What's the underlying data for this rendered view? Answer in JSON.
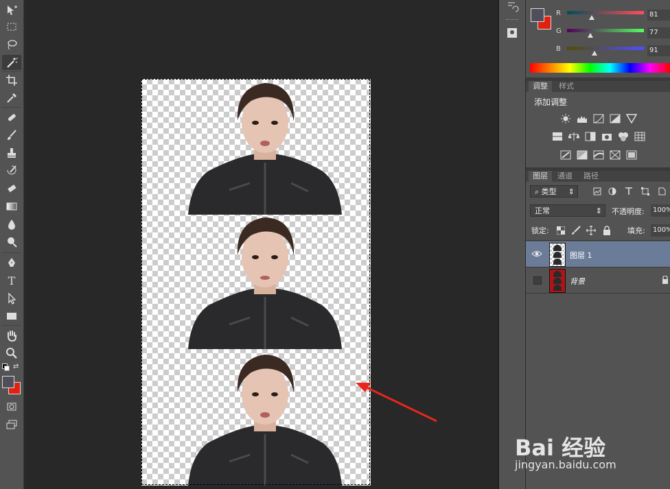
{
  "color_panel": {
    "r_label": "R",
    "g_label": "G",
    "b_label": "B",
    "r_value": "81",
    "g_value": "77",
    "b_value": "91",
    "foreground": "#514d5b",
    "background": "#e02010"
  },
  "adjust_panel": {
    "tabs": [
      "调整",
      "样式"
    ],
    "title": "添加调整"
  },
  "layers_panel": {
    "tabs": [
      "图层",
      "通道",
      "路径"
    ],
    "filter_label": "类型",
    "blend_mode": "正常",
    "opacity_label": "不透明度:",
    "opacity_value": "100%",
    "lock_label": "锁定:",
    "fill_label": "填充:",
    "fill_value": "100%",
    "layers": [
      {
        "name": "图层 1",
        "visible": true,
        "selected": true
      },
      {
        "name": "背景",
        "visible": false,
        "selected": false,
        "locked": true
      }
    ]
  },
  "toolbar": {
    "icons": [
      "move-icon",
      "marquee-icon",
      "lasso-icon",
      "magic-wand-icon",
      "crop-icon",
      "eyedropper-icon",
      "healing-brush-icon",
      "brush-icon",
      "stamp-icon",
      "history-brush-icon",
      "eraser-icon",
      "gradient-icon",
      "blur-icon",
      "dodge-icon",
      "pen-icon",
      "type-icon",
      "path-select-icon",
      "rectangle-icon",
      "hand-icon",
      "zoom-icon"
    ],
    "text_tool_glyph": "T"
  },
  "watermark": {
    "brand": "Bai 经验",
    "url": "jingyan.baidu.com"
  }
}
